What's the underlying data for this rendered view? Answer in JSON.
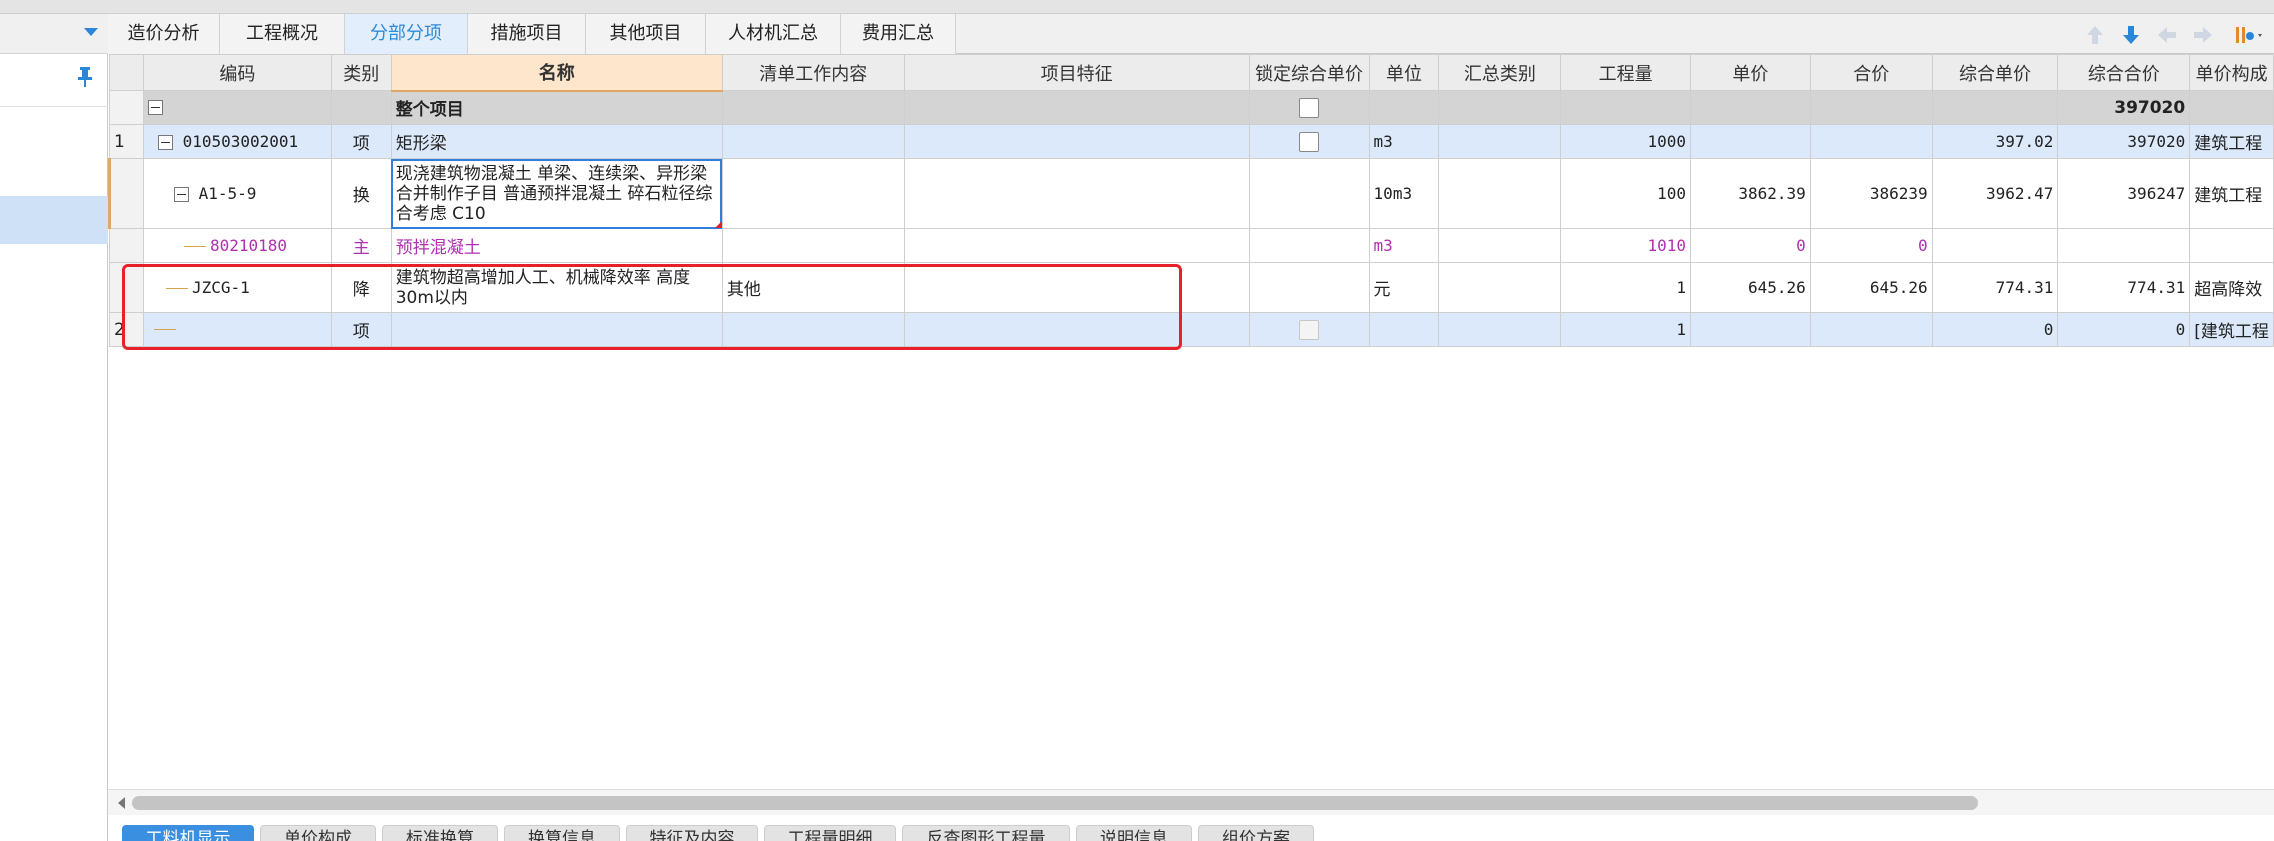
{
  "tabs": [
    {
      "label": "造价分析"
    },
    {
      "label": "工程概况"
    },
    {
      "label": "分部分项",
      "active": true
    },
    {
      "label": "措施项目"
    },
    {
      "label": "其他项目"
    },
    {
      "label": "人材机汇总"
    },
    {
      "label": "费用汇总"
    }
  ],
  "columns": {
    "code": "编码",
    "type": "类别",
    "name": "名称",
    "work": "清单工作内容",
    "feature": "项目特征",
    "lock": "锁定综合单价",
    "unit": "单位",
    "sumtype": "汇总类别",
    "qty": "工程量",
    "price": "单价",
    "total": "合价",
    "cprice": "综合单价",
    "ctotal": "综合合价",
    "pcomp": "单价构成"
  },
  "rows": {
    "whole": {
      "name": "整个项目",
      "ctotal": "397020"
    },
    "r1": {
      "num": "1",
      "code": "010503002001",
      "type": "项",
      "name": "矩形梁",
      "unit": "m3",
      "qty": "1000",
      "cprice": "397.02",
      "ctotal": "397020",
      "pcomp": "建筑工程"
    },
    "r2": {
      "code": "A1-5-9",
      "type": "换",
      "name": "现浇建筑物混凝土 单梁、连续梁、异形梁  合并制作子目 普通预拌混凝土 碎石粒径综合考虑 C10",
      "unit": "10m3",
      "qty": "100",
      "price": "3862.39",
      "total": "386239",
      "cprice": "3962.47",
      "ctotal": "396247",
      "pcomp": "建筑工程"
    },
    "r3": {
      "code": "80210180",
      "type": "主",
      "name": "预拌混凝土",
      "unit": "m3",
      "qty": "1010",
      "price": "0",
      "total": "0"
    },
    "r4": {
      "code": "JZCG-1",
      "type": "降",
      "name": "建筑物超高增加人工、机械降效率 高度30m以内",
      "work": "其他",
      "unit": "元",
      "qty": "1",
      "price": "645.26",
      "total": "645.26",
      "cprice": "774.31",
      "ctotal": "774.31",
      "pcomp": "超高降效"
    },
    "r5": {
      "num": "2",
      "type": "项",
      "qty": "1",
      "cprice": "0",
      "ctotal": "0",
      "pcomp": "[建筑工程"
    }
  },
  "bottom_tabs": [
    {
      "label": "工料机显示",
      "active": true
    },
    {
      "label": "单价构成"
    },
    {
      "label": "标准换算"
    },
    {
      "label": "换算信息"
    },
    {
      "label": "特征及内容"
    },
    {
      "label": "工程量明细"
    },
    {
      "label": "反查图形工程量"
    },
    {
      "label": "说明信息"
    },
    {
      "label": "组价方案"
    }
  ],
  "colors": {
    "accent": "#2f8ad8",
    "highlight": "#e8202a",
    "main_material": "#b030b0"
  },
  "icons": [
    "dropdown-arrow-icon",
    "pin-icon",
    "arrow-up-icon",
    "arrow-down-icon",
    "arrow-left-icon",
    "arrow-right-icon",
    "tools-icon"
  ]
}
